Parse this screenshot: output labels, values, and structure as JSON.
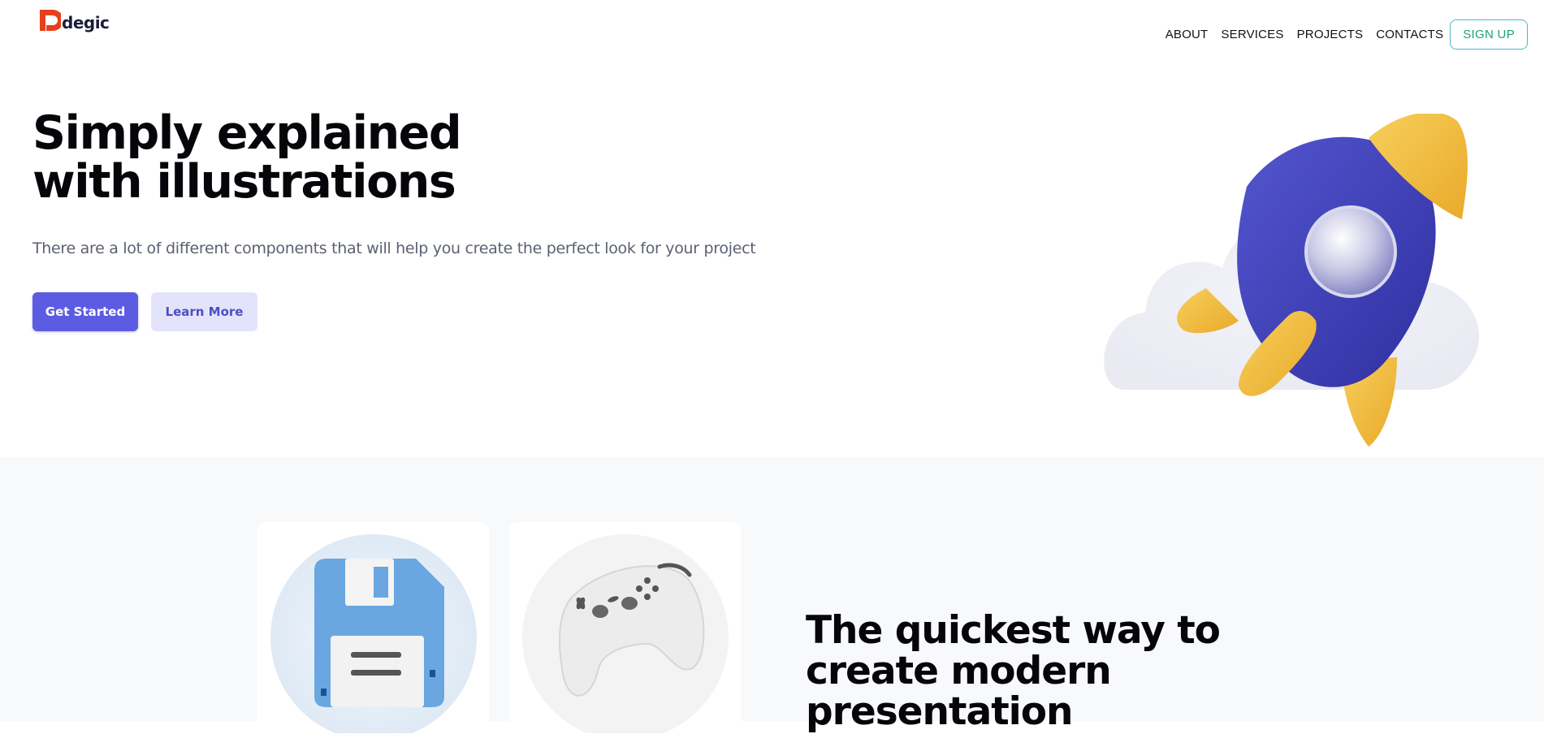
{
  "brand": {
    "name": "degic",
    "logo_color": "#e8401c"
  },
  "nav": {
    "items": [
      "ABOUT",
      "SERVICES",
      "PROJECTS",
      "CONTACTS"
    ],
    "signup_label": "SIGN UP"
  },
  "hero": {
    "title_line1": "Simply explained",
    "title_line2": "with illustrations",
    "subtitle": "There are a lot of different components that will help you create the perfect look for your project",
    "primary_button": "Get Started",
    "secondary_button": "Learn More",
    "illustration": "rocket-illustration"
  },
  "features": {
    "cards": [
      {
        "illustration": "floppy-disk-icon"
      },
      {
        "illustration": "gamepad-icon"
      }
    ],
    "title_line1": "The quickest way to",
    "title_line2": "create modern",
    "title_line3": "presentation"
  },
  "colors": {
    "primary": "#5b5ce2",
    "secondary_bg": "#e3e4fb",
    "signup_text": "#18a56b",
    "signup_border": "#4fb6c9",
    "section_bg": "#f8f9fa"
  }
}
